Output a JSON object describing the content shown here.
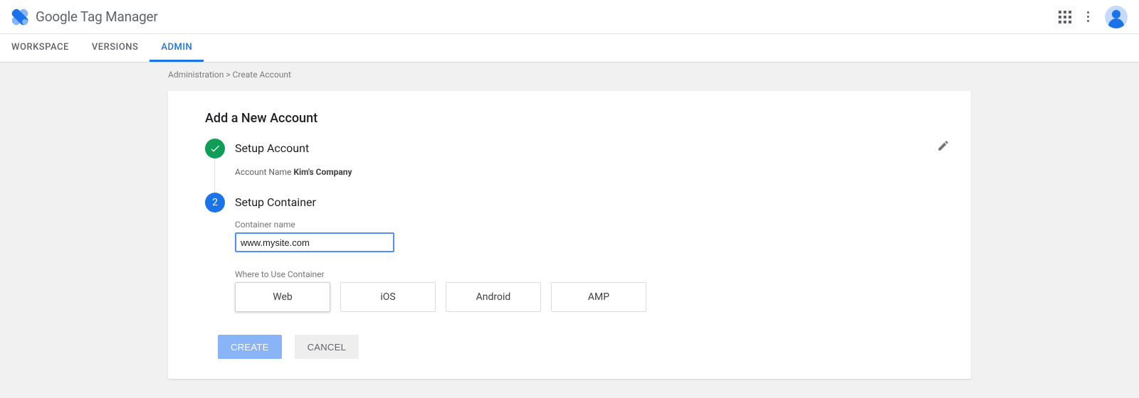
{
  "header": {
    "product_name": "Google Tag Manager"
  },
  "nav": {
    "tabs": [
      {
        "label": "WORKSPACE",
        "active": false
      },
      {
        "label": "VERSIONS",
        "active": false
      },
      {
        "label": "ADMIN",
        "active": true
      }
    ]
  },
  "breadcrumb": {
    "parent": "Administration",
    "separator": ">",
    "current": "Create Account"
  },
  "form": {
    "title": "Add a New Account",
    "step1": {
      "title": "Setup Account",
      "summary_label": "Account Name",
      "summary_value": "Kim's Company",
      "indicator": "✓"
    },
    "step2": {
      "number": "2",
      "title": "Setup Container",
      "container_name_label": "Container name",
      "container_name_value": "www.mysite.com",
      "where_label": "Where to Use Container",
      "platforms": [
        {
          "label": "Web",
          "selected": true
        },
        {
          "label": "iOS",
          "selected": false
        },
        {
          "label": "Android",
          "selected": false
        },
        {
          "label": "AMP",
          "selected": false
        }
      ]
    },
    "actions": {
      "create": "CREATE",
      "cancel": "CANCEL"
    }
  }
}
